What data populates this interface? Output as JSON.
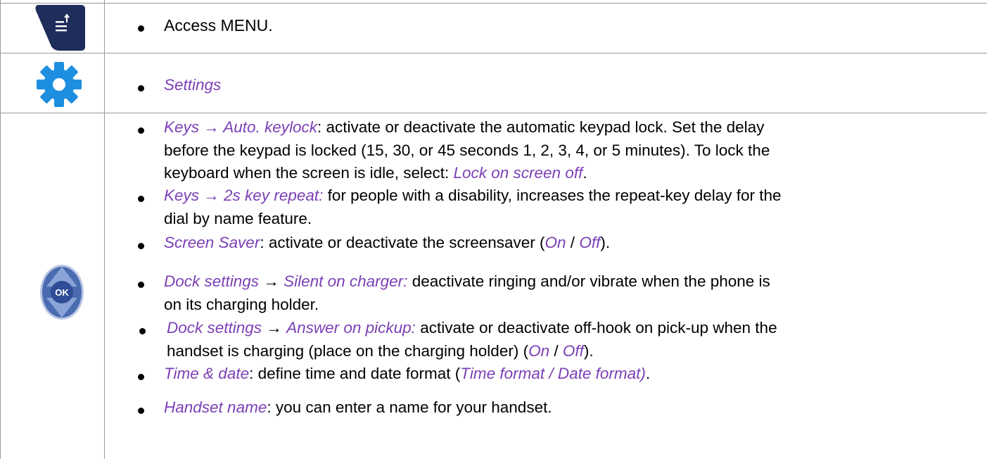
{
  "rows": [
    {
      "icon": "menu-icon",
      "text": "Access MENU."
    },
    {
      "icon": "gear-icon",
      "text": "Settings"
    },
    {
      "icon": "ok-navigator-icon",
      "ok_label": "OK",
      "items": [
        {
          "p1": "Keys",
          "arrow": " → ",
          "p2": "Auto. keylock",
          "t1": ": activate or deactivate the automatic keypad lock. Set the delay",
          "t2": "before the keypad is locked (15, 30, or 45 seconds 1, 2, 3, 4, or 5 minutes). To lock the",
          "t3": "keyboard when the screen is idle, select: ",
          "p3": "Lock on screen off",
          "t4": "."
        },
        {
          "p1": "Keys",
          "arrow": " → ",
          "p2": "2s key repeat:",
          "t1": " for people with a disability, increases the repeat-key delay for the",
          "t2": "dial by name feature."
        },
        {
          "p1": "Screen Saver",
          "t1": ": activate or deactivate the screensaver (",
          "p2": "On",
          "t2": " / ",
          "p3": "Off",
          "t3": ")."
        },
        {
          "p1": "Dock settings",
          "arrow": " → ",
          "p2": "Silent on charger:",
          "t1": " deactivate ringing and/or vibrate when the phone is",
          "t2": "on its charging holder."
        },
        {
          "p1": "Dock settings",
          "arrow": " → ",
          "p2": "Answer on pickup:",
          "t1": " activate or deactivate off-hook on pick-up when the",
          "t2": "handset is charging (place on the charging holder) (",
          "p3": "On",
          "t3": " / ",
          "p4": "Off",
          "t4": ")."
        },
        {
          "p1": "Time & date",
          "t1": ": define time and date format (",
          "p2": "Time format / Date format)",
          "t2": "."
        },
        {
          "p1": "Handset name",
          "t1": ": you can enter a name for your handset."
        }
      ]
    }
  ]
}
